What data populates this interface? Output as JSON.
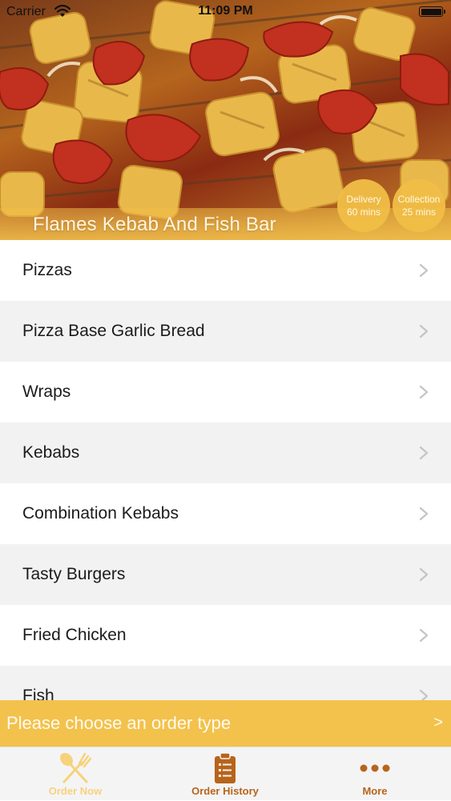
{
  "status_bar": {
    "carrier": "Carrier",
    "time": "11:09 PM"
  },
  "restaurant": {
    "name": "Flames Kebab And Fish Bar",
    "delivery": {
      "label": "Delivery",
      "time": "60 mins"
    },
    "collection": {
      "label": "Collection",
      "time": "25 mins"
    }
  },
  "menu": {
    "categories": [
      {
        "label": "Pizzas"
      },
      {
        "label": "Pizza Base Garlic Bread"
      },
      {
        "label": "Wraps"
      },
      {
        "label": "Kebabs"
      },
      {
        "label": "Combination Kebabs"
      },
      {
        "label": "Tasty Burgers"
      },
      {
        "label": "Fried Chicken"
      },
      {
        "label": "Fish"
      }
    ]
  },
  "order_bar": {
    "text": "Please choose an order type",
    "arrow": ">"
  },
  "tabs": {
    "order_now": "Order Now",
    "order_history": "Order History",
    "more": "More"
  },
  "colors": {
    "accent": "#f3c24c",
    "tab_active": "#f7d27c",
    "tab_inactive": "#b8641a"
  },
  "icons": {
    "order_now": "fork-spoon-icon",
    "order_history": "clipboard-list-icon",
    "more": "more-dots-icon",
    "chevron": "chevron-right-icon"
  }
}
